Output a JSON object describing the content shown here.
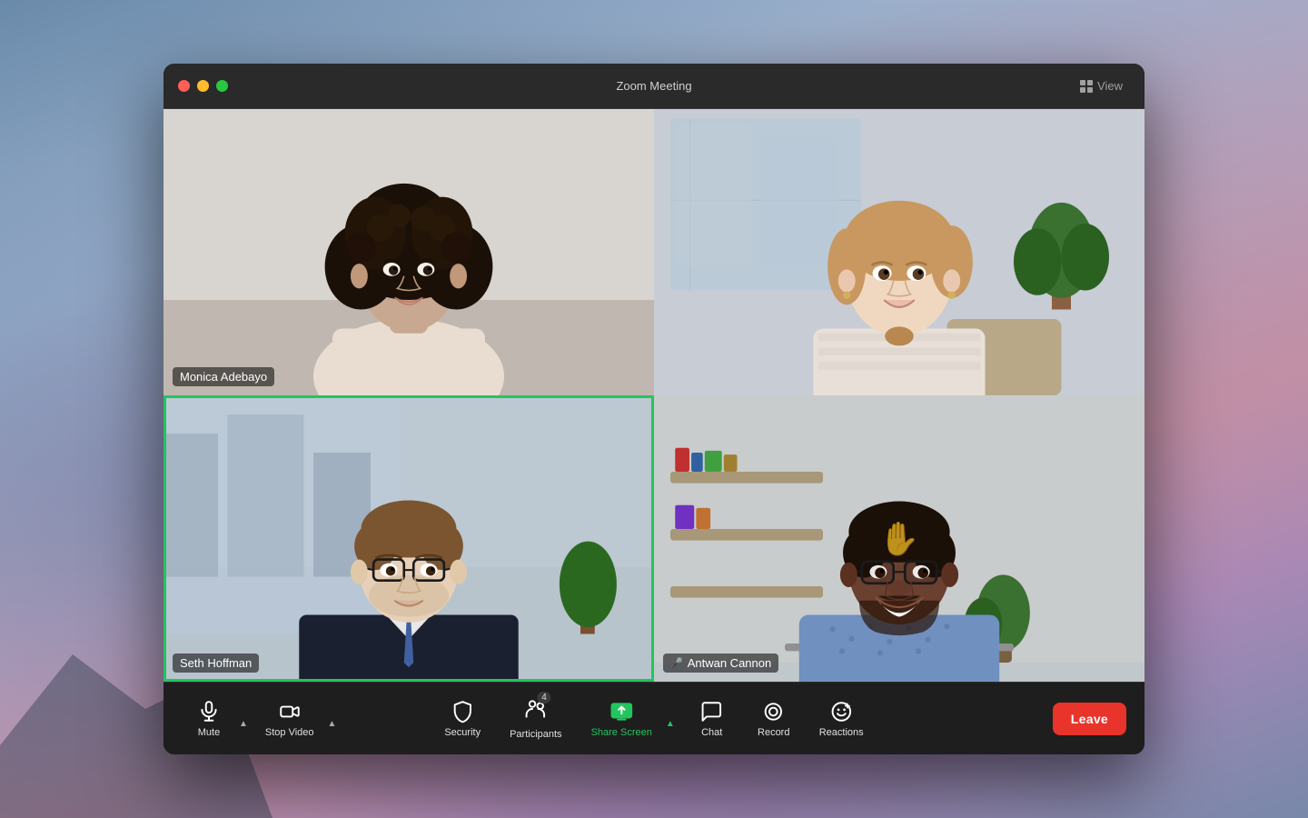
{
  "window": {
    "title": "Zoom Meeting",
    "view_label": "View",
    "traffic_lights": [
      "close",
      "minimize",
      "maximize"
    ]
  },
  "participants": [
    {
      "id": "monica",
      "name": "Monica Adebayo",
      "position": "top-left",
      "active_speaker": false,
      "mic_muted": false,
      "tile_index": 1
    },
    {
      "id": "woman2",
      "name": "",
      "position": "top-right",
      "active_speaker": false,
      "mic_muted": false,
      "tile_index": 2
    },
    {
      "id": "seth",
      "name": "Seth Hoffman",
      "position": "bottom-left",
      "active_speaker": true,
      "mic_muted": false,
      "tile_index": 3
    },
    {
      "id": "antwan",
      "name": "Antwan Cannon",
      "position": "bottom-right",
      "active_speaker": false,
      "mic_muted": true,
      "tile_index": 4,
      "has_reaction": true,
      "reaction": "✋"
    }
  ],
  "toolbar": {
    "mute_label": "Mute",
    "stop_video_label": "Stop Video",
    "security_label": "Security",
    "participants_label": "Participants",
    "participants_count": "4",
    "share_screen_label": "Share Screen",
    "chat_label": "Chat",
    "record_label": "Record",
    "reactions_label": "Reactions",
    "leave_label": "Leave"
  },
  "colors": {
    "active_speaker_border": "#22c55e",
    "share_screen_green": "#22c55e",
    "leave_red": "#e8342a",
    "toolbar_bg": "#1e1e1e",
    "titlebar_bg": "#2a2a2a",
    "mic_muted_red": "#ff4444"
  }
}
